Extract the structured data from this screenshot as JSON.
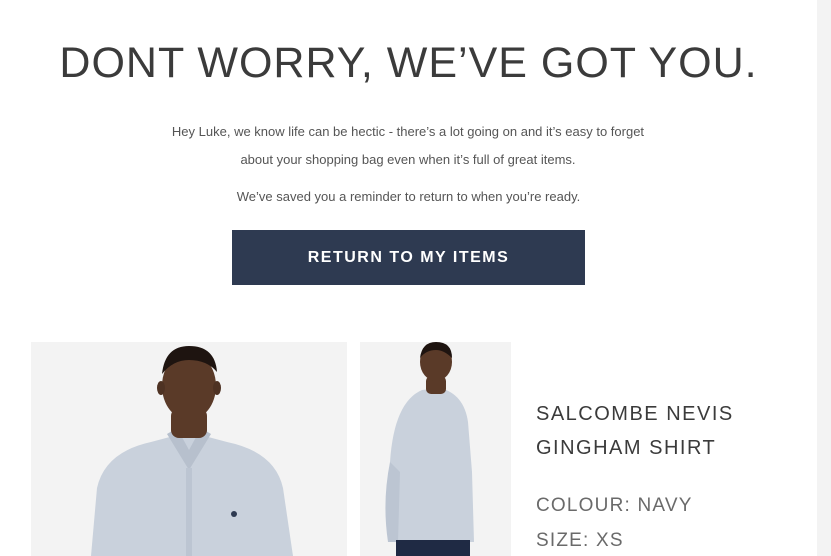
{
  "email": {
    "headline": "DONT WORRY, WE’VE GOT YOU.",
    "intro_line_1": "Hey Luke, we know life can be hectic - there’s a lot going on and it’s easy to forget",
    "intro_line_2": "about your shopping bag even when it’s full of great items.",
    "reminder": "We’ve saved you a reminder to return to when you’re ready.",
    "cta_label": "RETURN TO MY ITEMS"
  },
  "product": {
    "name_line_1": "SALCOMBE NEVIS",
    "name_line_2": "GINGHAM SHIRT",
    "colour_label": "COLOUR:",
    "colour_value": "NAVY",
    "size_label": "SIZE:",
    "size_value": "XS",
    "images": [
      {
        "view": "front"
      },
      {
        "view": "back"
      }
    ]
  },
  "colors": {
    "button_bg": "#2e3a51",
    "button_text": "#ffffff",
    "heading_text": "#3b3b3b",
    "body_text": "#555555",
    "shirt": "#c9d1dc",
    "skin": "#5a3a28"
  }
}
